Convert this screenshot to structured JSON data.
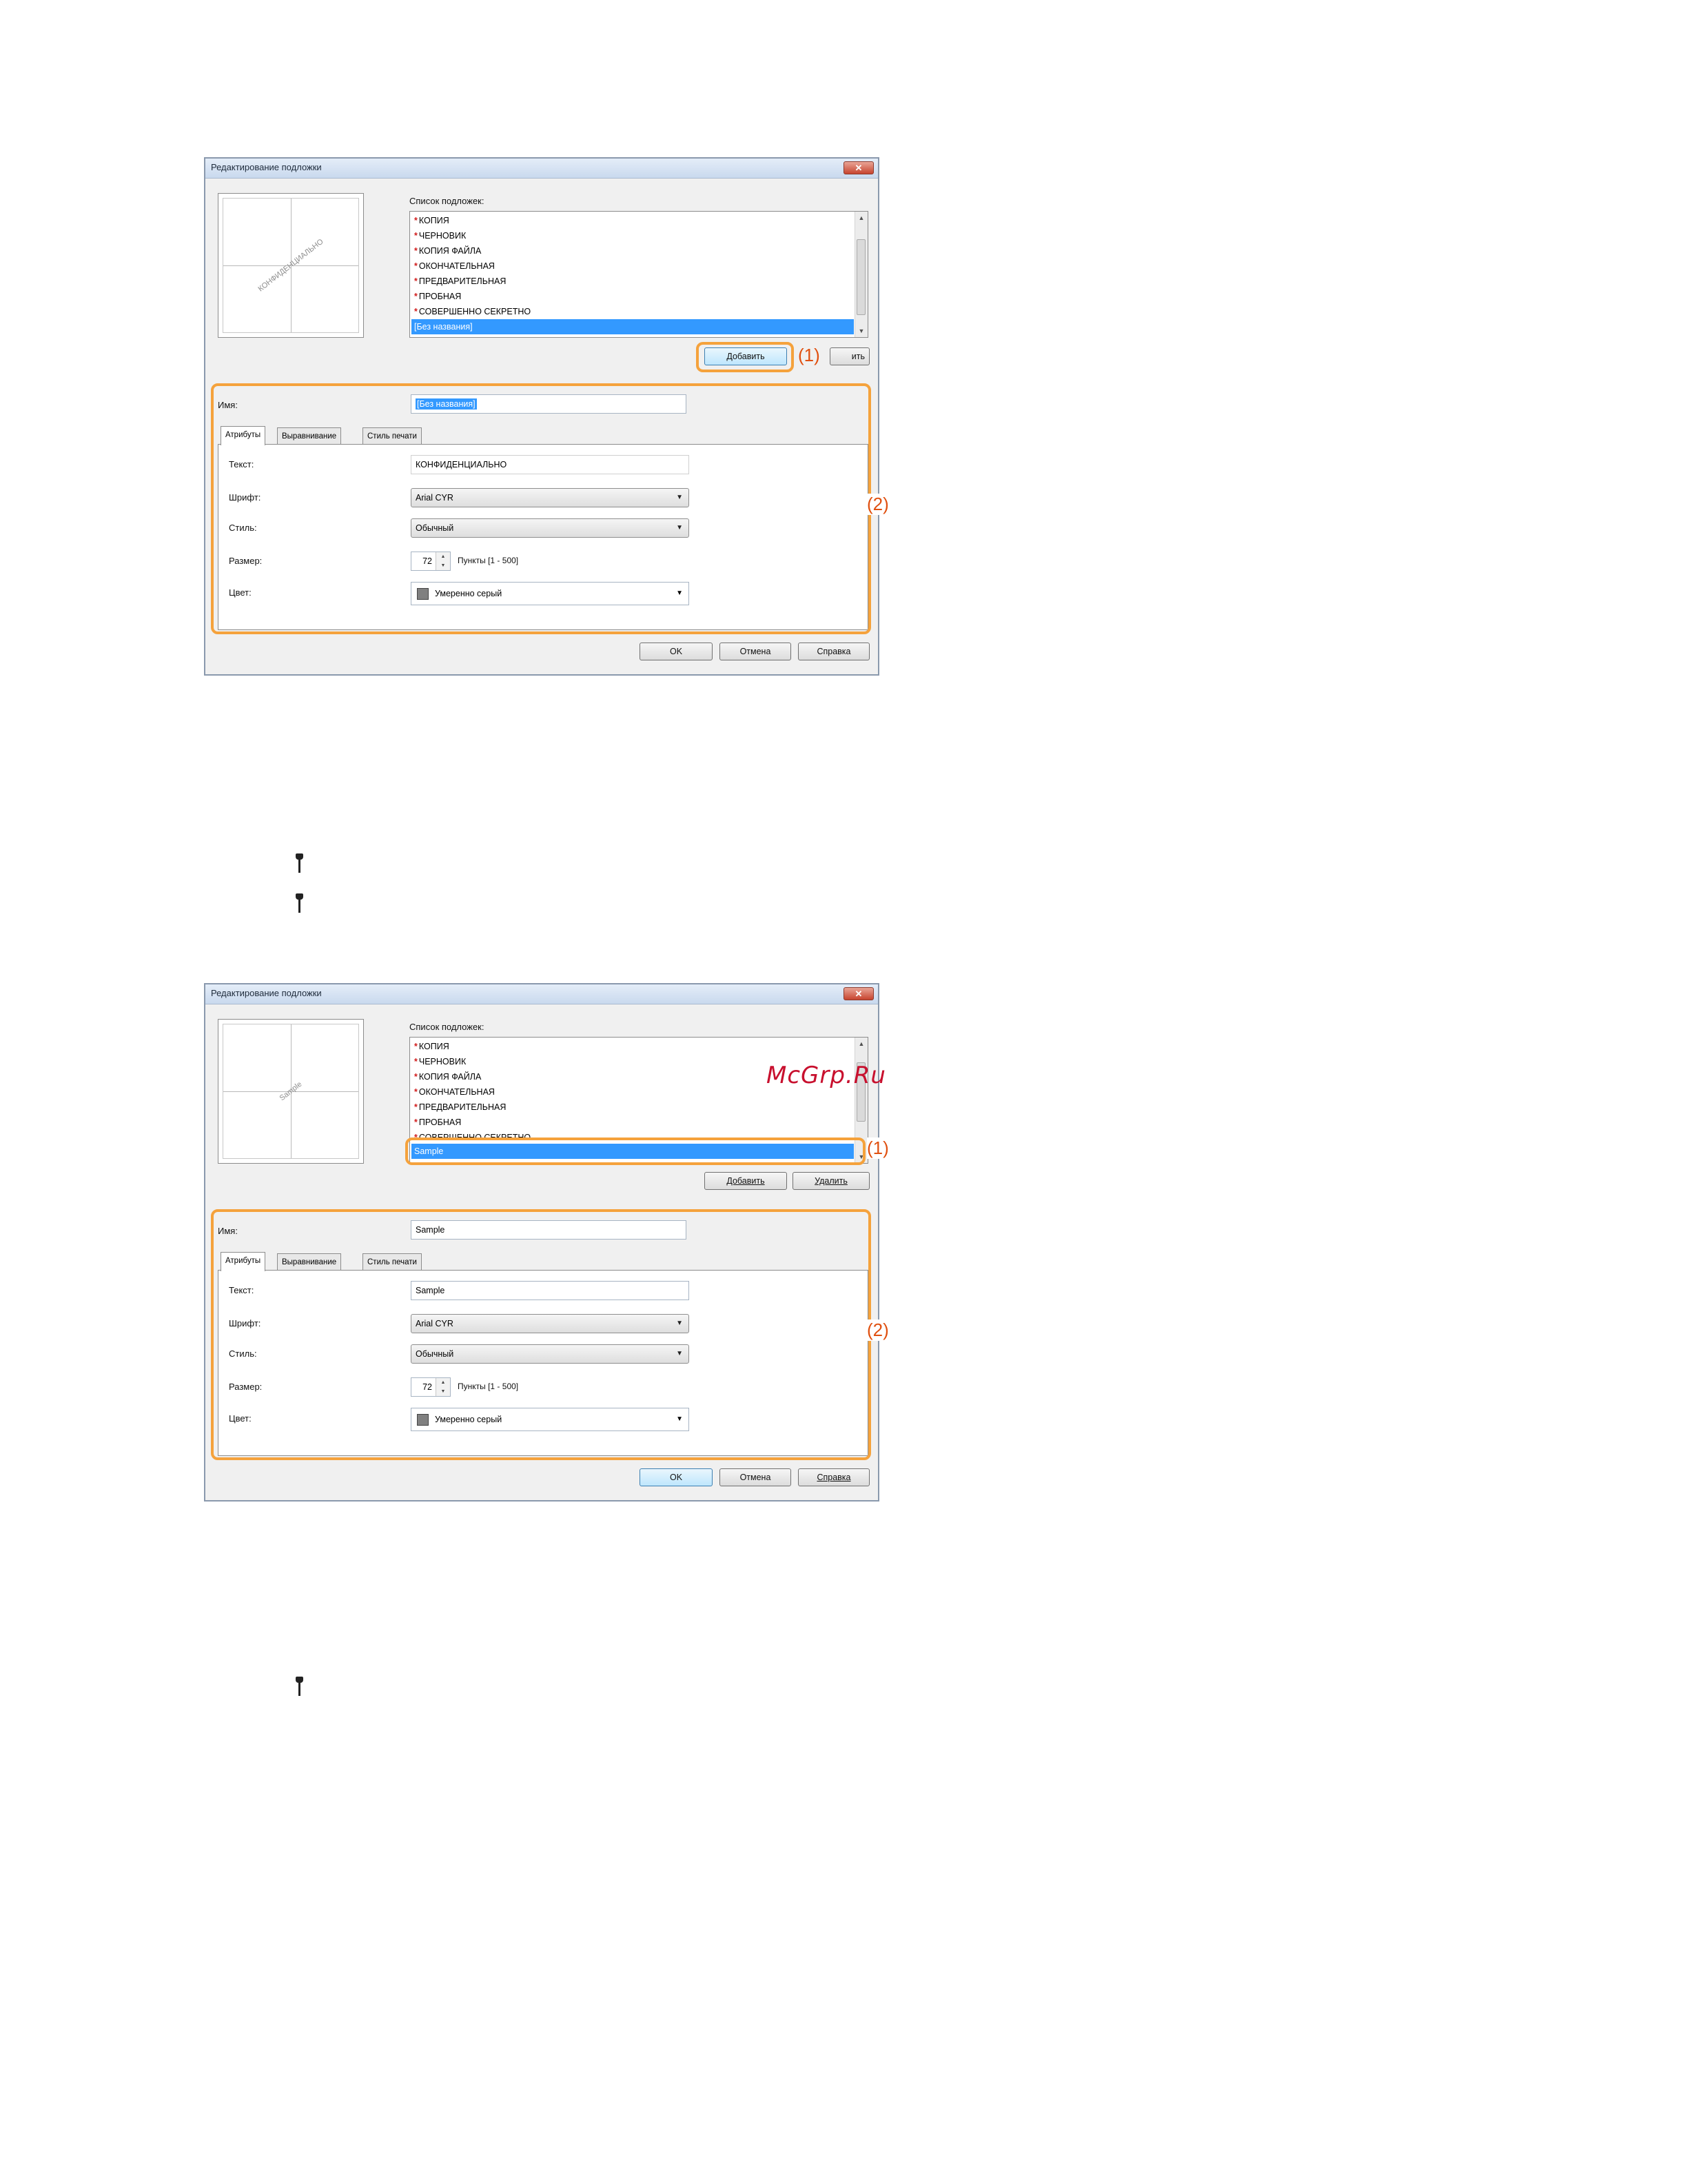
{
  "dialog1": {
    "title": "Редактирование подложки",
    "preview_text": "КОНФИДЕНЦИАЛЬНО",
    "list_label": "Список подложек:",
    "list_items": [
      "КОПИЯ",
      "ЧЕРНОВИК",
      "КОПИЯ ФАЙЛА",
      "ОКОНЧАТЕЛЬНАЯ",
      "ПРЕДВАРИТЕЛЬНАЯ",
      "ПРОБНАЯ",
      "СОВЕРШЕННО СЕКРЕТНО"
    ],
    "list_selected": "[Без названия]",
    "add_button": "Добавить",
    "delete_button_partial": "ить",
    "callout_1": "(1)",
    "callout_2": "(2)",
    "name_label": "Имя:",
    "name_value": "[Без названия]",
    "tabs": [
      "Атрибуты",
      "Выравнивание",
      "Стиль печати"
    ],
    "text_label": "Текст:",
    "text_value": "КОНФИДЕНЦИАЛЬНО",
    "font_label": "Шрифт:",
    "font_value": "Arial CYR",
    "style_label": "Стиль:",
    "style_value": "Обычный",
    "size_label": "Размер:",
    "size_value": "72",
    "size_units": "Пункты [1 - 500]",
    "color_label": "Цвет:",
    "color_value": "Умеренно серый",
    "ok": "OK",
    "cancel": "Отмена",
    "help": "Справка"
  },
  "dialog2": {
    "title": "Редактирование подложки",
    "preview_text": "Sample",
    "list_label": "Список подложек:",
    "list_items": [
      "КОПИЯ",
      "ЧЕРНОВИК",
      "КОПИЯ ФАЙЛА",
      "ОКОНЧАТЕЛЬНАЯ",
      "ПРЕДВАРИТЕЛЬНАЯ",
      "ПРОБНАЯ",
      "СОВЕРШЕННО СЕКРЕТНО"
    ],
    "list_selected": "Sample",
    "add_button": "Добавить",
    "delete_button": "Удалить",
    "callout_1": "(1)",
    "callout_2": "(2)",
    "name_label": "Имя:",
    "name_value": "Sample",
    "tabs": [
      "Атрибуты",
      "Выравнивание",
      "Стиль печати"
    ],
    "text_label": "Текст:",
    "text_value": "Sample",
    "font_label": "Шрифт:",
    "font_value": "Arial CYR",
    "style_label": "Стиль:",
    "style_value": "Обычный",
    "size_label": "Размер:",
    "size_value": "72",
    "size_units": "Пункты [1 - 500]",
    "color_label": "Цвет:",
    "color_value": "Умеренно серый",
    "ok": "OK",
    "cancel": "Отмена",
    "help": "Справка"
  },
  "site_watermark": "McGrp.Ru",
  "colors": {
    "highlight": "#f5a23c",
    "callout": "#e05010",
    "selection": "#3399ff",
    "site_watermark": "#c8102e"
  },
  "icons": [
    "close-icon",
    "bullet-icon",
    "scroll-up-icon",
    "scroll-down-icon",
    "dropdown-caret-icon",
    "spin-up-icon",
    "spin-down-icon",
    "color-swatch-icon"
  ]
}
